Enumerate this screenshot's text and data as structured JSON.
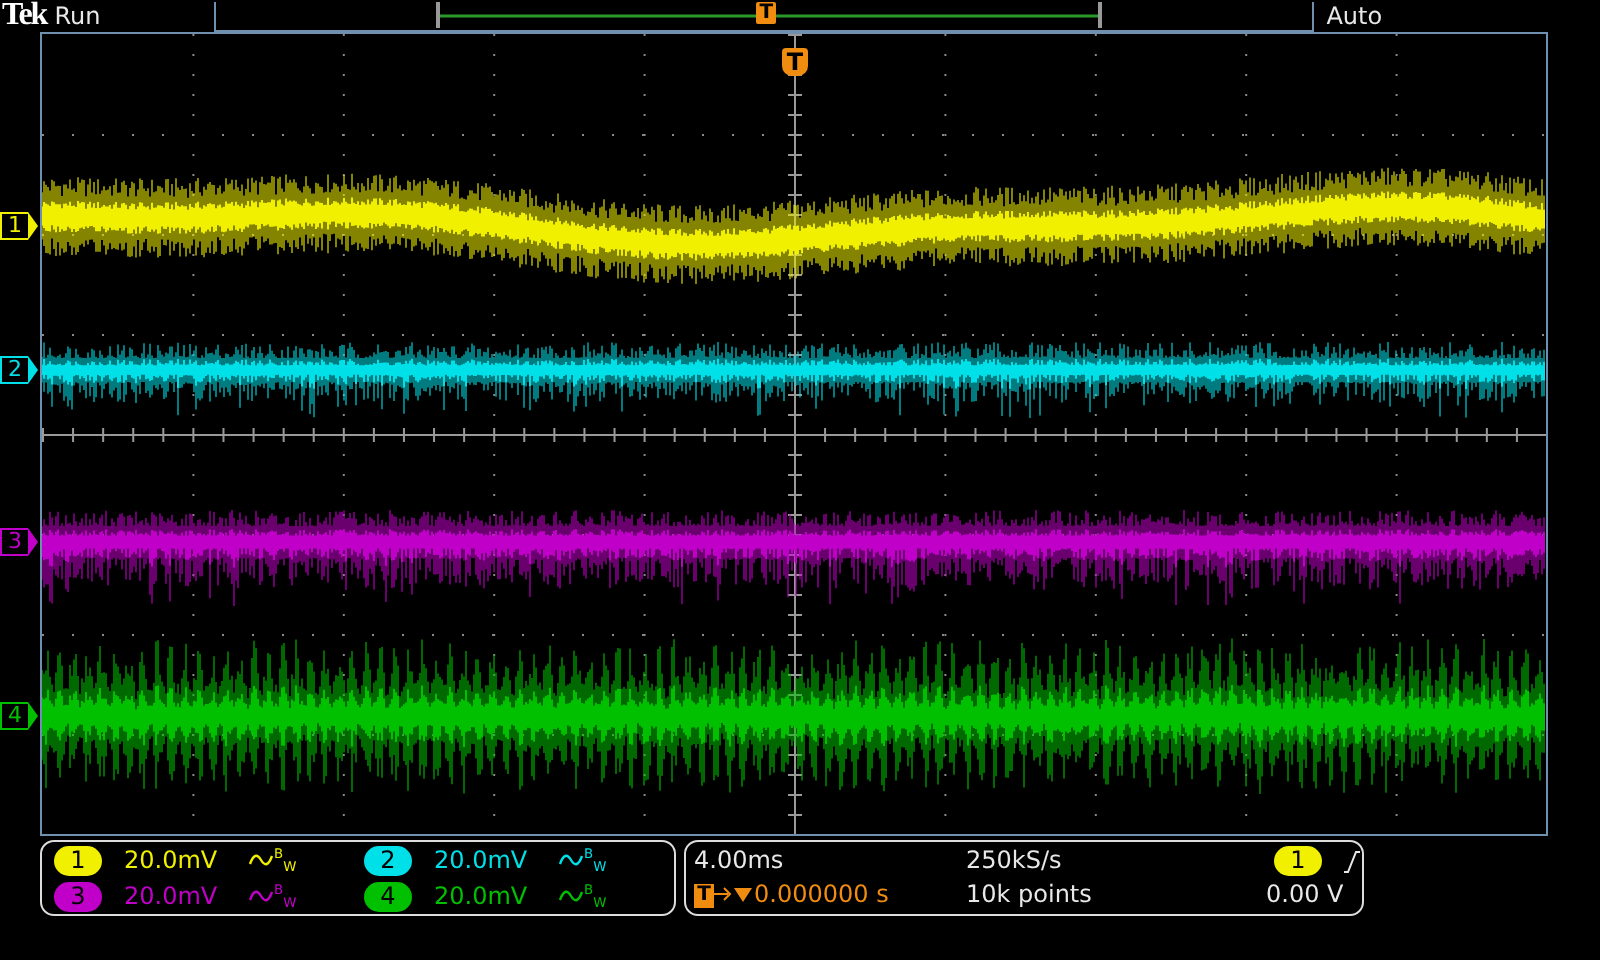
{
  "top_bar": {
    "logo": "Tek",
    "acquisition_state": "Run",
    "trigger_marker": "T",
    "trigger_mode": "Auto"
  },
  "graticule": {
    "trigger_marker": "T"
  },
  "channels": [
    {
      "label": "1",
      "badge_label": "1",
      "color": "#f0f000",
      "scale": "20.0mV",
      "bandwidth": "$^{B}$$_{W}$"
    },
    {
      "label": "2",
      "badge_label": "2",
      "color": "#00e0e8",
      "scale": "20.0mV",
      "bandwidth": "$^{B}$$_{W}$"
    },
    {
      "label": "3",
      "badge_label": "3",
      "color": "#c000c8",
      "scale": "20.0mV",
      "bandwidth": "$^{B}$$_{W}$"
    },
    {
      "label": "4",
      "badge_label": "4",
      "color": "#00c000",
      "scale": "20.0mV",
      "bandwidth": "$^{B}$$_{W}$"
    }
  ],
  "horizontal": {
    "scale": "4.00ms",
    "trigger_icon": "T",
    "position": "0.000000 s",
    "sample_rate": "250kS/s",
    "record_length": "10k points"
  },
  "trigger": {
    "source": "1",
    "level": "0.00 V"
  }
}
